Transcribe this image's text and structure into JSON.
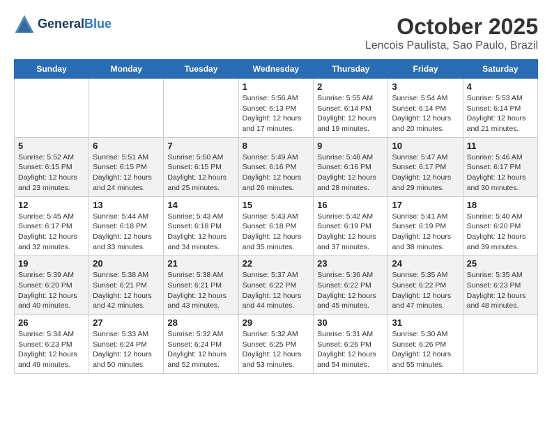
{
  "header": {
    "logo_line1": "General",
    "logo_line2": "Blue",
    "month": "October 2025",
    "location": "Lencois Paulista, Sao Paulo, Brazil"
  },
  "days_of_week": [
    "Sunday",
    "Monday",
    "Tuesday",
    "Wednesday",
    "Thursday",
    "Friday",
    "Saturday"
  ],
  "weeks": [
    [
      {
        "num": "",
        "sunrise": "",
        "sunset": "",
        "daylight": ""
      },
      {
        "num": "",
        "sunrise": "",
        "sunset": "",
        "daylight": ""
      },
      {
        "num": "",
        "sunrise": "",
        "sunset": "",
        "daylight": ""
      },
      {
        "num": "1",
        "sunrise": "Sunrise: 5:56 AM",
        "sunset": "Sunset: 6:13 PM",
        "daylight": "Daylight: 12 hours and 17 minutes."
      },
      {
        "num": "2",
        "sunrise": "Sunrise: 5:55 AM",
        "sunset": "Sunset: 6:14 PM",
        "daylight": "Daylight: 12 hours and 19 minutes."
      },
      {
        "num": "3",
        "sunrise": "Sunrise: 5:54 AM",
        "sunset": "Sunset: 6:14 PM",
        "daylight": "Daylight: 12 hours and 20 minutes."
      },
      {
        "num": "4",
        "sunrise": "Sunrise: 5:53 AM",
        "sunset": "Sunset: 6:14 PM",
        "daylight": "Daylight: 12 hours and 21 minutes."
      }
    ],
    [
      {
        "num": "5",
        "sunrise": "Sunrise: 5:52 AM",
        "sunset": "Sunset: 6:15 PM",
        "daylight": "Daylight: 12 hours and 23 minutes."
      },
      {
        "num": "6",
        "sunrise": "Sunrise: 5:51 AM",
        "sunset": "Sunset: 6:15 PM",
        "daylight": "Daylight: 12 hours and 24 minutes."
      },
      {
        "num": "7",
        "sunrise": "Sunrise: 5:50 AM",
        "sunset": "Sunset: 6:15 PM",
        "daylight": "Daylight: 12 hours and 25 minutes."
      },
      {
        "num": "8",
        "sunrise": "Sunrise: 5:49 AM",
        "sunset": "Sunset: 6:16 PM",
        "daylight": "Daylight: 12 hours and 26 minutes."
      },
      {
        "num": "9",
        "sunrise": "Sunrise: 5:48 AM",
        "sunset": "Sunset: 6:16 PM",
        "daylight": "Daylight: 12 hours and 28 minutes."
      },
      {
        "num": "10",
        "sunrise": "Sunrise: 5:47 AM",
        "sunset": "Sunset: 6:17 PM",
        "daylight": "Daylight: 12 hours and 29 minutes."
      },
      {
        "num": "11",
        "sunrise": "Sunrise: 5:46 AM",
        "sunset": "Sunset: 6:17 PM",
        "daylight": "Daylight: 12 hours and 30 minutes."
      }
    ],
    [
      {
        "num": "12",
        "sunrise": "Sunrise: 5:45 AM",
        "sunset": "Sunset: 6:17 PM",
        "daylight": "Daylight: 12 hours and 32 minutes."
      },
      {
        "num": "13",
        "sunrise": "Sunrise: 5:44 AM",
        "sunset": "Sunset: 6:18 PM",
        "daylight": "Daylight: 12 hours and 33 minutes."
      },
      {
        "num": "14",
        "sunrise": "Sunrise: 5:43 AM",
        "sunset": "Sunset: 6:18 PM",
        "daylight": "Daylight: 12 hours and 34 minutes."
      },
      {
        "num": "15",
        "sunrise": "Sunrise: 5:43 AM",
        "sunset": "Sunset: 6:18 PM",
        "daylight": "Daylight: 12 hours and 35 minutes."
      },
      {
        "num": "16",
        "sunrise": "Sunrise: 5:42 AM",
        "sunset": "Sunset: 6:19 PM",
        "daylight": "Daylight: 12 hours and 37 minutes."
      },
      {
        "num": "17",
        "sunrise": "Sunrise: 5:41 AM",
        "sunset": "Sunset: 6:19 PM",
        "daylight": "Daylight: 12 hours and 38 minutes."
      },
      {
        "num": "18",
        "sunrise": "Sunrise: 5:40 AM",
        "sunset": "Sunset: 6:20 PM",
        "daylight": "Daylight: 12 hours and 39 minutes."
      }
    ],
    [
      {
        "num": "19",
        "sunrise": "Sunrise: 5:39 AM",
        "sunset": "Sunset: 6:20 PM",
        "daylight": "Daylight: 12 hours and 40 minutes."
      },
      {
        "num": "20",
        "sunrise": "Sunrise: 5:38 AM",
        "sunset": "Sunset: 6:21 PM",
        "daylight": "Daylight: 12 hours and 42 minutes."
      },
      {
        "num": "21",
        "sunrise": "Sunrise: 5:38 AM",
        "sunset": "Sunset: 6:21 PM",
        "daylight": "Daylight: 12 hours and 43 minutes."
      },
      {
        "num": "22",
        "sunrise": "Sunrise: 5:37 AM",
        "sunset": "Sunset: 6:22 PM",
        "daylight": "Daylight: 12 hours and 44 minutes."
      },
      {
        "num": "23",
        "sunrise": "Sunrise: 5:36 AM",
        "sunset": "Sunset: 6:22 PM",
        "daylight": "Daylight: 12 hours and 45 minutes."
      },
      {
        "num": "24",
        "sunrise": "Sunrise: 5:35 AM",
        "sunset": "Sunset: 6:22 PM",
        "daylight": "Daylight: 12 hours and 47 minutes."
      },
      {
        "num": "25",
        "sunrise": "Sunrise: 5:35 AM",
        "sunset": "Sunset: 6:23 PM",
        "daylight": "Daylight: 12 hours and 48 minutes."
      }
    ],
    [
      {
        "num": "26",
        "sunrise": "Sunrise: 5:34 AM",
        "sunset": "Sunset: 6:23 PM",
        "daylight": "Daylight: 12 hours and 49 minutes."
      },
      {
        "num": "27",
        "sunrise": "Sunrise: 5:33 AM",
        "sunset": "Sunset: 6:24 PM",
        "daylight": "Daylight: 12 hours and 50 minutes."
      },
      {
        "num": "28",
        "sunrise": "Sunrise: 5:32 AM",
        "sunset": "Sunset: 6:24 PM",
        "daylight": "Daylight: 12 hours and 52 minutes."
      },
      {
        "num": "29",
        "sunrise": "Sunrise: 5:32 AM",
        "sunset": "Sunset: 6:25 PM",
        "daylight": "Daylight: 12 hours and 53 minutes."
      },
      {
        "num": "30",
        "sunrise": "Sunrise: 5:31 AM",
        "sunset": "Sunset: 6:26 PM",
        "daylight": "Daylight: 12 hours and 54 minutes."
      },
      {
        "num": "31",
        "sunrise": "Sunrise: 5:30 AM",
        "sunset": "Sunset: 6:26 PM",
        "daylight": "Daylight: 12 hours and 55 minutes."
      },
      {
        "num": "",
        "sunrise": "",
        "sunset": "",
        "daylight": ""
      }
    ]
  ]
}
